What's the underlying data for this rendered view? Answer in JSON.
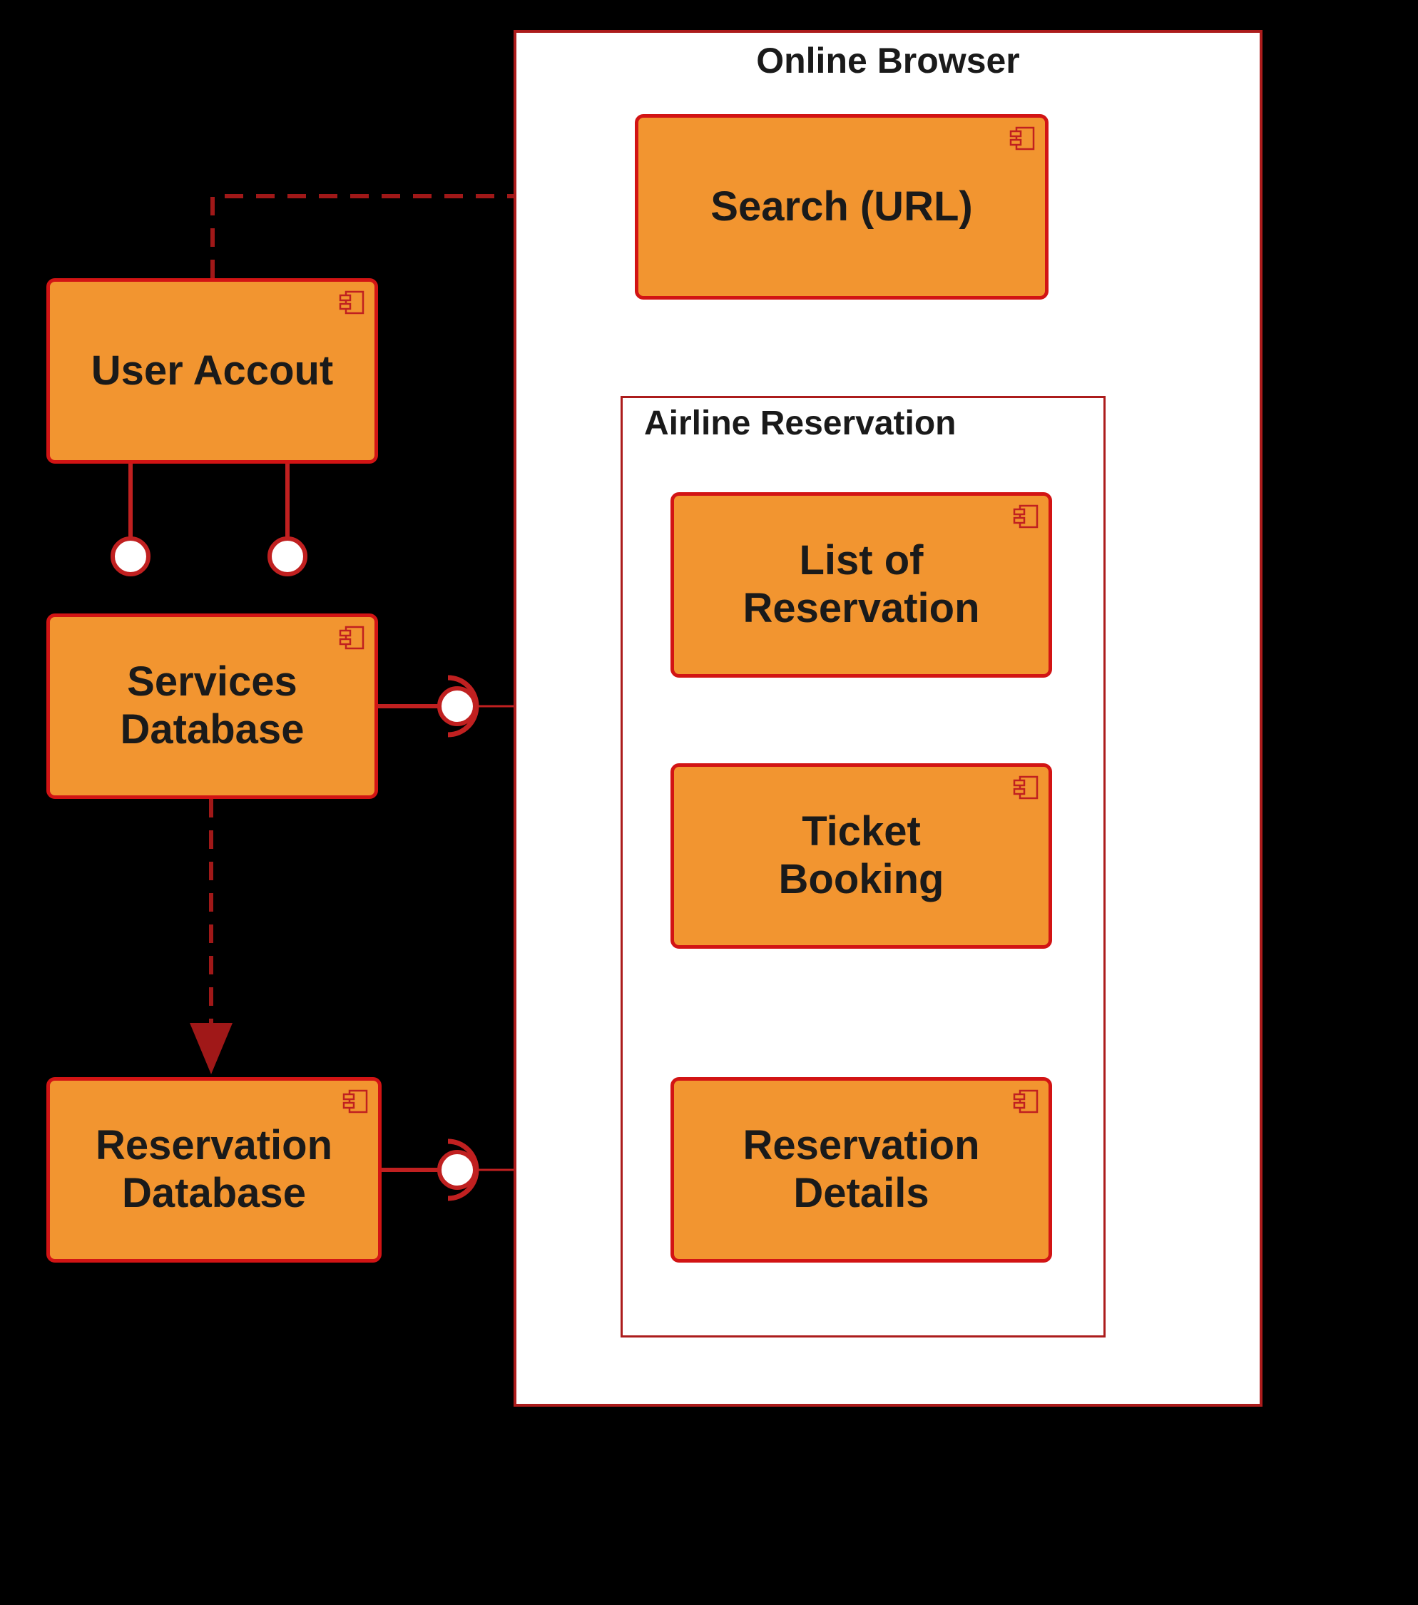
{
  "containers": {
    "onlineBrowser": {
      "title": "Online Browser"
    },
    "airlineReservation": {
      "title": "Airline Reservation"
    }
  },
  "components": {
    "userAccount": {
      "label": "User Accout"
    },
    "servicesDatabase": {
      "label": "Services\nDatabase"
    },
    "reservationDatabase": {
      "label": "Reservation\nDatabase"
    },
    "searchUrl": {
      "label": "Search (URL)"
    },
    "listOfReservation": {
      "label": "List of\nReservation"
    },
    "ticketBooking": {
      "label": "Ticket\nBooking"
    },
    "reservationDetails": {
      "label": "Reservation\nDetails"
    }
  },
  "colors": {
    "containerBorder": "#ac1c1c",
    "componentFill": "#f29530",
    "componentBorder": "#d21414",
    "lineColor": "#c02020",
    "lineColorDark": "#a01818"
  }
}
